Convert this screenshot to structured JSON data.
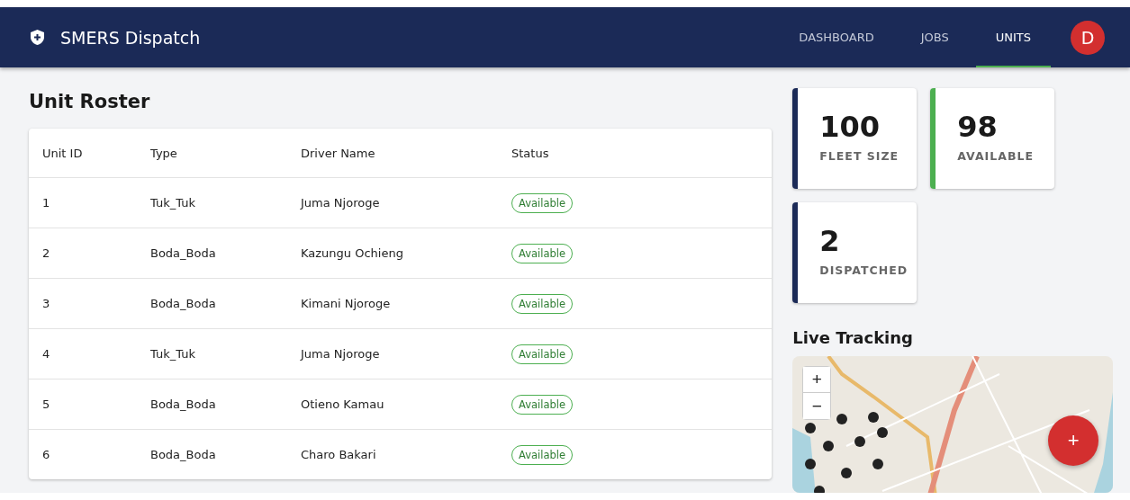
{
  "app": {
    "title": "SMERS Dispatch"
  },
  "nav": [
    {
      "label": "DASHBOARD",
      "selected": false
    },
    {
      "label": "JOBS",
      "selected": false
    },
    {
      "label": "UNITS",
      "selected": true
    }
  ],
  "avatar": "D",
  "roster": {
    "title": "Unit Roster",
    "columns": [
      "Unit ID",
      "Type",
      "Driver Name",
      "Status"
    ],
    "rows": [
      {
        "id": "1",
        "type": "Tuk_Tuk",
        "driver": "Juma Njoroge",
        "status": "Available"
      },
      {
        "id": "2",
        "type": "Boda_Boda",
        "driver": "Kazungu Ochieng",
        "status": "Available"
      },
      {
        "id": "3",
        "type": "Boda_Boda",
        "driver": "Kimani Njoroge",
        "status": "Available"
      },
      {
        "id": "4",
        "type": "Tuk_Tuk",
        "driver": "Juma Njoroge",
        "status": "Available"
      },
      {
        "id": "5",
        "type": "Boda_Boda",
        "driver": "Otieno Kamau",
        "status": "Available"
      },
      {
        "id": "6",
        "type": "Boda_Boda",
        "driver": "Charo Bakari",
        "status": "Available"
      }
    ]
  },
  "stats": [
    {
      "value": "100",
      "label": "FLEET SIZE",
      "color": "#1b2a57"
    },
    {
      "value": "98",
      "label": "AVAILABLE",
      "color": "#4caf50"
    },
    {
      "value": "2",
      "label": "DISPATCHED",
      "color": "#1b2a57"
    }
  ],
  "tracking": {
    "title": "Live Tracking",
    "zoom_in": "+",
    "zoom_out": "−",
    "fab": "+"
  }
}
